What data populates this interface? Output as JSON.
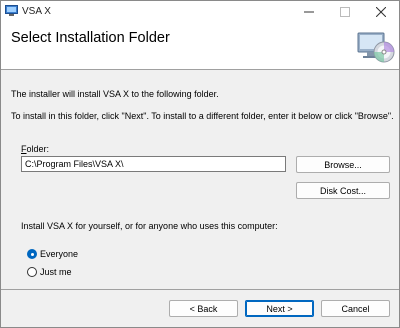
{
  "window": {
    "title": "VSA X"
  },
  "header": {
    "title": "Select Installation Folder"
  },
  "body": {
    "intro_line1": "The installer will install VSA X to the following folder.",
    "intro_line2": "To install in this folder, click \"Next\". To install to a different folder, enter it below or click \"Browse\".",
    "folder_label": "Folder:",
    "folder_value": "C:\\Program Files\\VSA X\\",
    "browse_label": "Browse...",
    "disk_cost_label": "Disk Cost...",
    "install_for_label": "Install VSA X for yourself, or for anyone who uses this computer:",
    "options": [
      {
        "label": "Everyone",
        "selected": true
      },
      {
        "label": "Just me",
        "selected": false
      }
    ]
  },
  "footer": {
    "back_label": "< Back",
    "next_label": "Next >",
    "cancel_label": "Cancel"
  },
  "icons": [
    "app-icon",
    "minimize-icon",
    "maximize-icon",
    "close-icon",
    "installer-disc-icon"
  ],
  "colors": {
    "accent": "#0067c0",
    "header_bg": "#ffffff",
    "dialog_bg": "#f0f0f0"
  }
}
